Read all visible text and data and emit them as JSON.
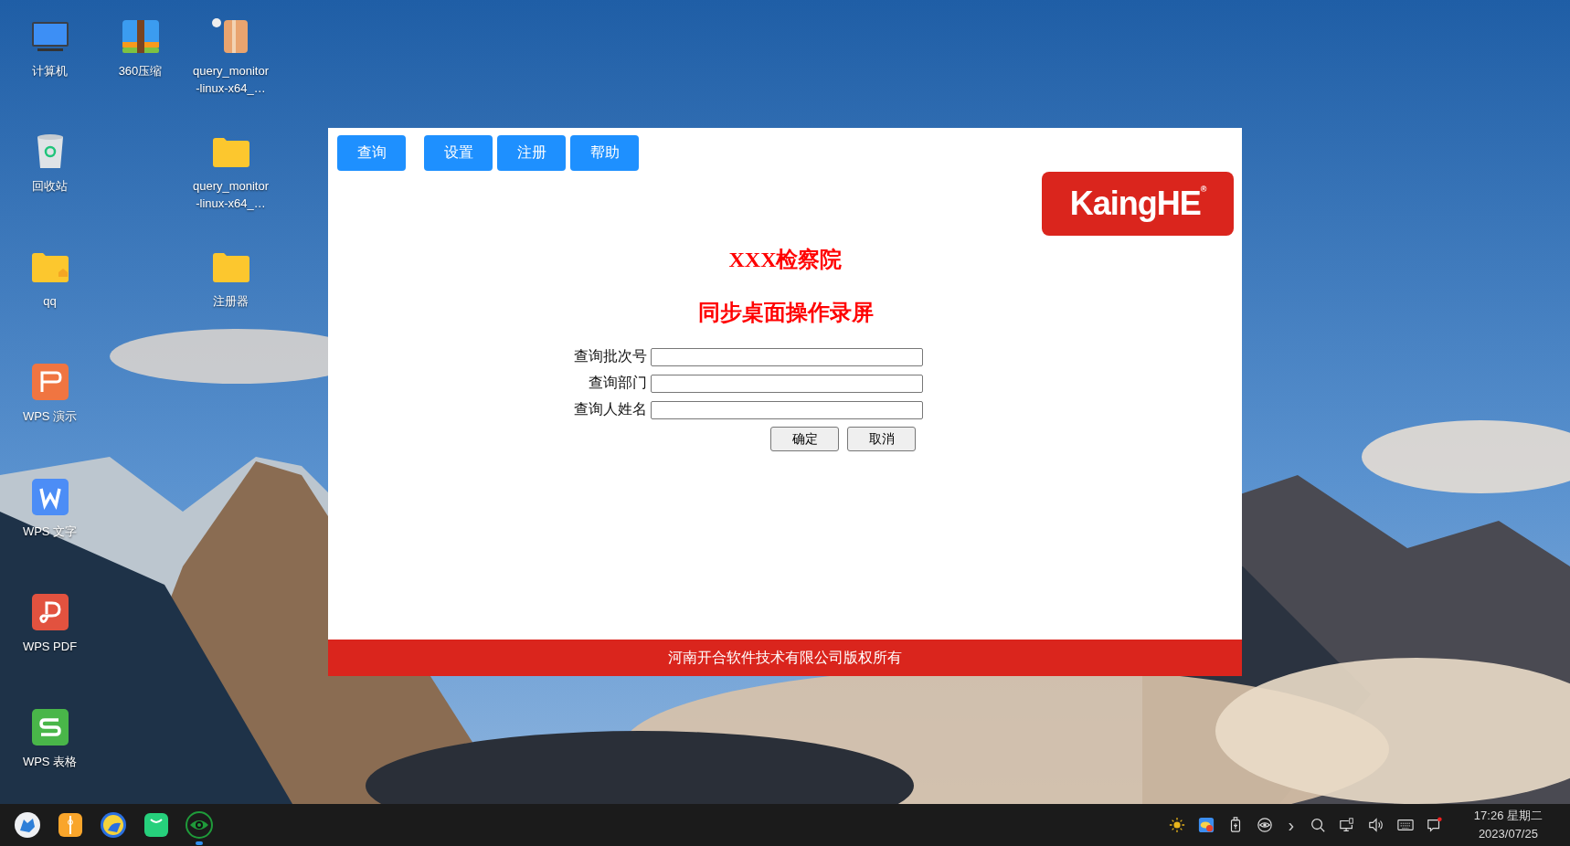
{
  "desktop_columns": [
    [
      {
        "label": "计算机",
        "kind": "monitor"
      },
      {
        "label": "回收站",
        "kind": "trash"
      },
      {
        "label": "qq",
        "kind": "folder-home"
      },
      {
        "label": "WPS 演示",
        "kind": "wps-p"
      },
      {
        "label": "WPS 文字",
        "kind": "wps-w"
      },
      {
        "label": "WPS PDF",
        "kind": "wps-pdf"
      },
      {
        "label": "WPS 表格",
        "kind": "wps-s"
      }
    ],
    [
      {
        "label": "360压缩",
        "kind": "archive"
      }
    ],
    [
      {
        "label": "query_monitor-linux-x64_…",
        "kind": "package"
      },
      {
        "label": "query_monitor-linux-x64_…",
        "kind": "folder"
      },
      {
        "label": "注册器",
        "kind": "folder"
      }
    ]
  ],
  "app_window": {
    "toolbar_groups": [
      [
        "查询"
      ],
      [
        "设置",
        "注册",
        "帮助"
      ]
    ],
    "logo": {
      "text": "KaingHE",
      "mark": "®"
    },
    "title": "XXX检察院",
    "subtitle": "同步桌面操作录屏",
    "fields": [
      {
        "label": "查询批次号"
      },
      {
        "label": "查询部门"
      },
      {
        "label": "查询人姓名"
      }
    ],
    "buttons": [
      "确定",
      "取消"
    ],
    "footer": "河南开合软件技术有限公司版权所有"
  },
  "taskbar": {
    "apps": [
      {
        "kind": "fox",
        "active": false
      },
      {
        "kind": "zipper",
        "active": false
      },
      {
        "kind": "leopard",
        "active": false
      },
      {
        "kind": "bag",
        "active": false
      },
      {
        "kind": "eye",
        "active": true
      }
    ],
    "tray": [
      {
        "kind": "sun"
      },
      {
        "kind": "weather"
      },
      {
        "kind": "usb"
      },
      {
        "kind": "eye"
      },
      {
        "kind": "chevron",
        "text": "›"
      },
      {
        "kind": "search"
      },
      {
        "kind": "network"
      },
      {
        "kind": "volume"
      },
      {
        "kind": "keyboard"
      },
      {
        "kind": "notification"
      }
    ],
    "time": "17:26 星期二",
    "date": "2023/07/25"
  }
}
